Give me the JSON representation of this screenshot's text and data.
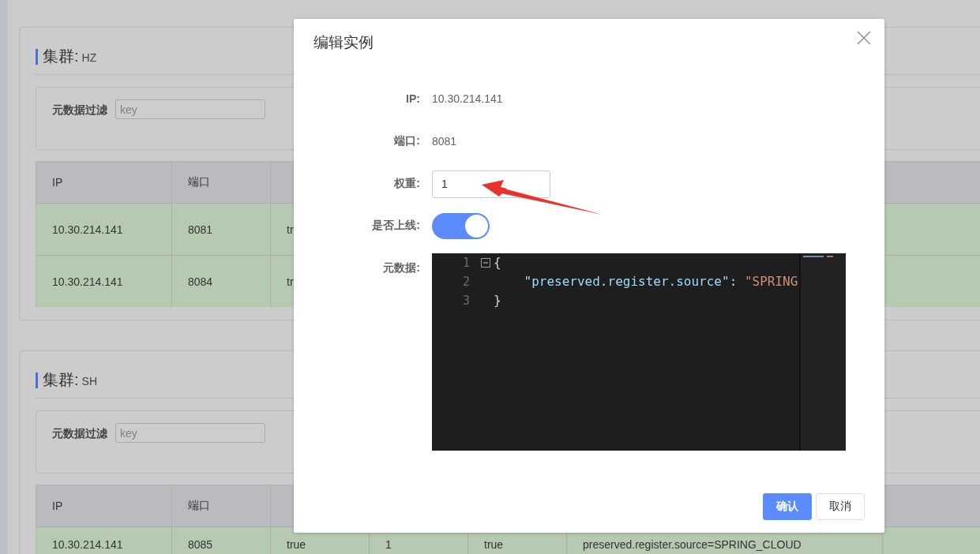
{
  "clusters": [
    {
      "title_label": "集群:",
      "name": "HZ",
      "filter": {
        "label": "元数据过滤",
        "placeholder": "key"
      },
      "table": {
        "columns": [
          "IP",
          "端口"
        ],
        "rows": [
          {
            "cells": [
              "10.30.214.141",
              "8081",
              "tr"
            ]
          },
          {
            "cells": [
              "10.30.214.141",
              "8084",
              "tr"
            ]
          }
        ]
      }
    },
    {
      "title_label": "集群:",
      "name": "SH",
      "filter": {
        "label": "元数据过滤",
        "placeholder": "key"
      },
      "table": {
        "columns": [
          "IP",
          "端口"
        ],
        "rows": [
          {
            "cells": [
              "10.30.214.141",
              "8085",
              "true",
              "1",
              "true",
              "preserved.register.source=SPRING_CLOUD"
            ]
          }
        ]
      }
    }
  ],
  "dialog": {
    "title": "编辑实例",
    "fields": [
      {
        "kind": "text",
        "label": "IP:",
        "value": "10.30.214.141"
      },
      {
        "kind": "text",
        "label": "端口:",
        "value": "8081"
      },
      {
        "kind": "input",
        "label": "权重:",
        "value": "1"
      },
      {
        "kind": "switch",
        "label": "是否上线:",
        "on": true
      },
      {
        "kind": "editor",
        "label": "元数据:",
        "lines": [
          {
            "number": "1",
            "fold": true,
            "tokens": [
              {
                "kind": "punct",
                "text": "{"
              }
            ]
          },
          {
            "number": "2",
            "fold": false,
            "tokens": [
              {
                "kind": "key",
                "text": "    \"preserved.register.source\""
              },
              {
                "kind": "punct",
                "text": ": "
              },
              {
                "kind": "string",
                "text": "\"SPRING"
              }
            ]
          },
          {
            "number": "3",
            "fold": false,
            "tokens": [
              {
                "kind": "punct",
                "text": "}"
              }
            ]
          }
        ]
      }
    ],
    "buttons": [
      {
        "label": "确认",
        "primary": true
      },
      {
        "label": "取消",
        "primary": false
      }
    ]
  }
}
